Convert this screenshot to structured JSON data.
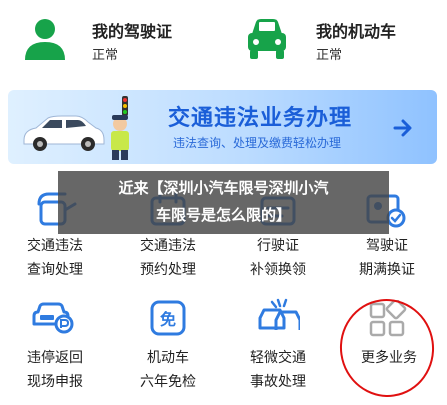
{
  "top_cards": [
    {
      "title": "我的驾驶证",
      "status": "正常",
      "icon": "driver-license-person-icon"
    },
    {
      "title": "我的机动车",
      "status": "正常",
      "icon": "car-front-icon"
    }
  ],
  "banner": {
    "title": "交通违法业务办理",
    "subtitle": "违法查询、处理及缴费轻松办理"
  },
  "overlay": {
    "line1": "近来【深圳小汽车限号深圳小汽",
    "line2": "车限号是怎么限的】"
  },
  "services": [
    {
      "line1": "交通违法",
      "line2": "查询处理",
      "icon": "violation-query-icon"
    },
    {
      "line1": "交通违法",
      "line2": "预约处理",
      "icon": "violation-appointment-icon"
    },
    {
      "line1": "行驶证",
      "line2": "补领换领",
      "icon": "vehicle-license-icon"
    },
    {
      "line1": "驾驶证",
      "line2": "期满换证",
      "icon": "license-renewal-icon"
    },
    {
      "line1": "违停返回",
      "line2": "现场申报",
      "icon": "parking-violation-icon"
    },
    {
      "line1": "机动车",
      "line2": "六年免检",
      "icon": "inspection-exempt-icon"
    },
    {
      "line1": "轻微交通",
      "line2": "事故处理",
      "icon": "minor-accident-icon"
    },
    {
      "line1": "更多业务",
      "line2": "",
      "icon": "more-grid-icon"
    }
  ],
  "colors": {
    "accent": "#1a5ed8",
    "green": "#17a34a",
    "icon_blue": "#2f7be0",
    "mark_red": "#e01010"
  }
}
